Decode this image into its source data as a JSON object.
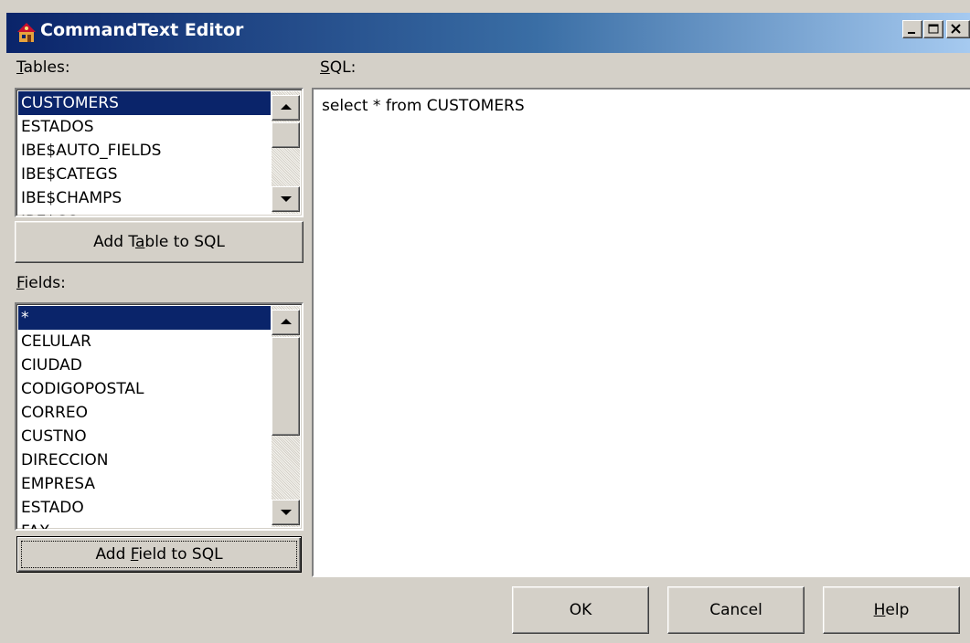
{
  "window": {
    "title": "CommandText Editor",
    "title_gradient": [
      "#0a246a",
      "#a6caf0"
    ]
  },
  "tables": {
    "label_pre": "",
    "label_key": "T",
    "label_post": "ables:",
    "items": [
      "CUSTOMERS",
      "ESTADOS",
      "IBE$AUTO_FIELDS",
      "IBE$CATEGS",
      "IBE$CHAMPS",
      "IBE$CO..."
    ],
    "selected": "CUSTOMERS",
    "add_button": {
      "pre": "Add T",
      "key": "a",
      "post": "ble to SQL"
    }
  },
  "fields": {
    "label_pre": "",
    "label_key": "F",
    "label_post": "ields:",
    "items": [
      "*",
      "CELULAR",
      "CIUDAD",
      "CODIGOPOSTAL",
      "CORREO",
      "CUSTNO",
      "DIRECCION",
      "EMPRESA",
      "ESTADO",
      "FAX"
    ],
    "selected": "*",
    "add_button": {
      "pre": "Add ",
      "key": "F",
      "post": "ield to SQL"
    }
  },
  "sql": {
    "label_pre": "",
    "label_key": "S",
    "label_post": "QL:",
    "text": "select * from CUSTOMERS"
  },
  "buttons": {
    "ok": "OK",
    "cancel": "Cancel",
    "help_key": "H",
    "help_post": "elp"
  },
  "colors": {
    "face": "#d4d0c8",
    "selection": "#0a246a"
  }
}
